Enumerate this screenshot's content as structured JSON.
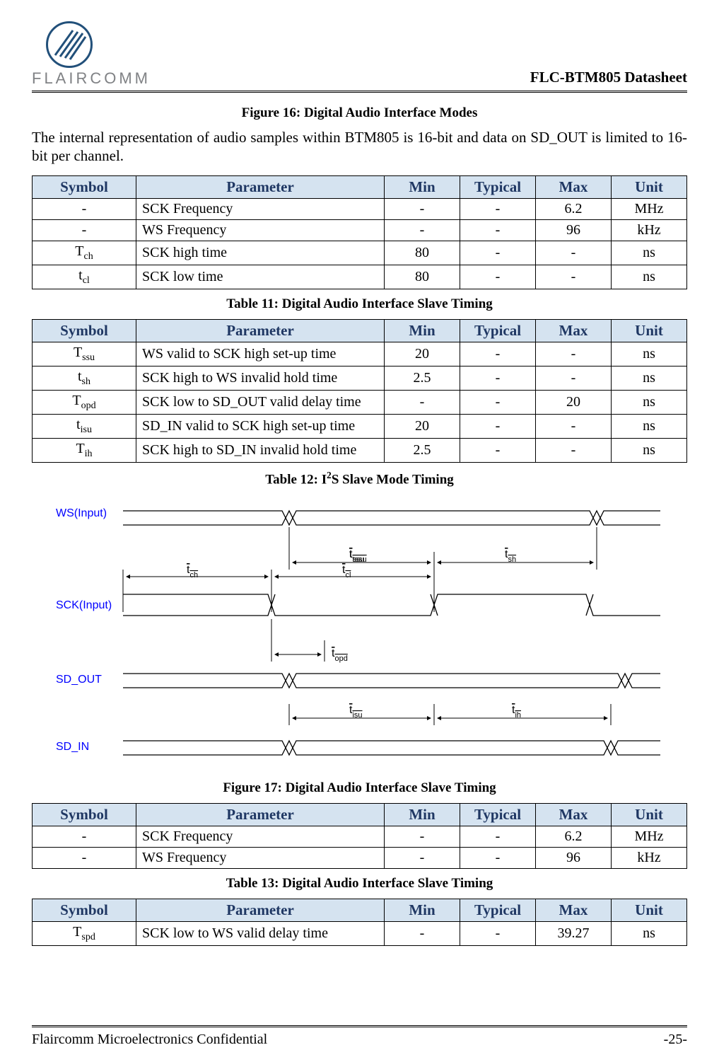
{
  "header": {
    "brand": "FLAIRCOMM",
    "doc_title": "FLC-BTM805 Datasheet"
  },
  "figure16_caption": "Figure 16: Digital Audio Interface Modes",
  "intro_text": "The internal representation of audio samples within BTM805 is 16-bit and data on SD_OUT is limited to 16-bit per channel.",
  "table_headers": {
    "symbol": "Symbol",
    "parameter": "Parameter",
    "min": "Min",
    "typical": "Typical",
    "max": "Max",
    "unit": "Unit"
  },
  "table11": {
    "rows": [
      {
        "symbol": "-",
        "param": "SCK Frequency",
        "min": "-",
        "typ": "-",
        "max": "6.2",
        "unit": "MHz"
      },
      {
        "symbol": "-",
        "param": "WS Frequency",
        "min": "-",
        "typ": "-",
        "max": "96",
        "unit": "kHz"
      },
      {
        "symbol": "T",
        "sub": "ch",
        "param": "SCK high time",
        "min": "80",
        "typ": "-",
        "max": "-",
        "unit": "ns"
      },
      {
        "symbol": "t",
        "sub": "cl",
        "param": "SCK low time",
        "min": "80",
        "typ": "-",
        "max": "-",
        "unit": "ns"
      }
    ],
    "caption": "Table 11: Digital Audio Interface Slave Timing"
  },
  "table12": {
    "rows": [
      {
        "symbol": "T",
        "sub": "ssu",
        "param": "WS valid to SCK high set-up time",
        "min": "20",
        "typ": "-",
        "max": "-",
        "unit": "ns"
      },
      {
        "symbol": "t",
        "sub": "sh",
        "param": "SCK high to WS invalid hold time",
        "min": "2.5",
        "typ": "-",
        "max": "-",
        "unit": "ns"
      },
      {
        "symbol": "T",
        "sub": "opd",
        "param": "SCK low to SD_OUT valid delay time",
        "min": "-",
        "typ": "-",
        "max": "20",
        "unit": "ns"
      },
      {
        "symbol": "t",
        "sub": "isu",
        "param": "SD_IN valid to SCK high set-up time",
        "min": "20",
        "typ": "-",
        "max": "-",
        "unit": "ns"
      },
      {
        "symbol": "T",
        "sub": "ih",
        "param": "SCK high to SD_IN invalid hold time",
        "min": "2.5",
        "typ": "-",
        "max": "-",
        "unit": "ns"
      }
    ],
    "caption_pre": "Table 12: I",
    "caption_sup": "2",
    "caption_post": "S Slave Mode Timing"
  },
  "diagram_labels": {
    "ws": "WS(Input)",
    "sck": "SCK(Input)",
    "sd_out": "SD_OUT",
    "sd_in": "SD_IN",
    "tssu": "tssu",
    "tsh": "tsh",
    "tch": "tch",
    "tcl": "tcl",
    "topd": "topd",
    "tisu": "tisu",
    "tih": "tih"
  },
  "figure17_caption": "Figure 17: Digital Audio Interface Slave Timing",
  "table13": {
    "rows": [
      {
        "symbol": "-",
        "param": "SCK Frequency",
        "min": "-",
        "typ": "-",
        "max": "6.2",
        "unit": "MHz"
      },
      {
        "symbol": "-",
        "param": "WS Frequency",
        "min": "-",
        "typ": "-",
        "max": "96",
        "unit": "kHz"
      }
    ],
    "caption": "Table 13: Digital Audio Interface Slave Timing"
  },
  "table14": {
    "rows": [
      {
        "symbol": "T",
        "sub": "spd",
        "param": "SCK low to WS valid delay time",
        "min": "-",
        "typ": "-",
        "max": "39.27",
        "unit": "ns"
      }
    ]
  },
  "footer": {
    "left": "Flaircomm Microelectronics Confidential",
    "right": "-25-"
  }
}
